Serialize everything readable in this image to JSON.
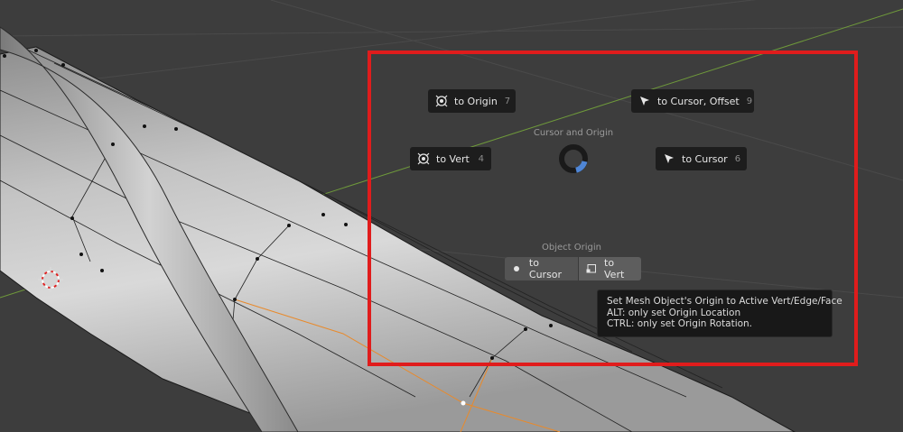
{
  "pie_menu": {
    "title": "Cursor and Origin",
    "buttons": {
      "to_origin": {
        "label": "to Origin",
        "key": "7",
        "icon": "origin-icon"
      },
      "to_cursor_offset": {
        "label": "to Cursor, Offset",
        "key": "9",
        "icon": "cursor-arrow-icon"
      },
      "to_vert": {
        "label": "to Vert",
        "key": "4",
        "icon": "origin-icon"
      },
      "to_cursor": {
        "label": "to Cursor",
        "key": "6",
        "icon": "cursor-arrow-icon"
      }
    },
    "direction_indicator": {
      "icon": "pie-direction-ring-icon",
      "accent": "#4f86d6"
    }
  },
  "object_origin": {
    "title": "Object Origin",
    "to_cursor_label": "to Cursor",
    "to_vert_label": "to Vert"
  },
  "tooltip": {
    "line1": "Set Mesh Object's Origin to Active Vert/Edge/Face",
    "line2": "ALT: only set Origin Location",
    "line3": "CTRL: only set Origin Rotation."
  },
  "colors": {
    "viewport_bg": "#3d3d3d",
    "highlight": "#e01c1c",
    "x_axis": "#b8433f",
    "y_axis": "#6f9a3b",
    "selection_edge": "#e88a2c"
  }
}
